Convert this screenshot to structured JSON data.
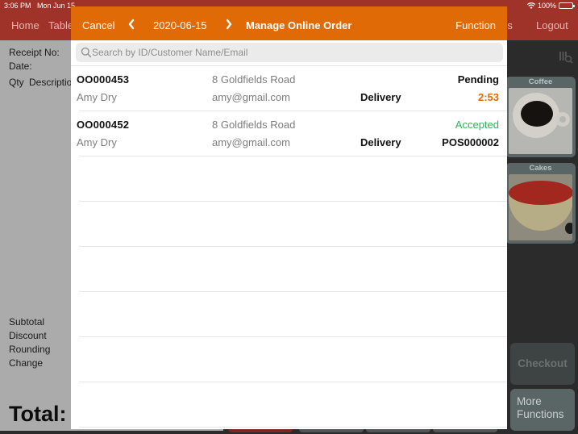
{
  "status_bar": {
    "time": "3:06 PM",
    "date": "Mon Jun 15",
    "battery": "100%"
  },
  "top_nav": {
    "home": "Home",
    "table": "Table",
    "functions": "ions",
    "logout": "Logout"
  },
  "receipt": {
    "receipt_no_label": "Receipt No:",
    "date_label": "Date:",
    "qty_label": "Qty",
    "description_label": "Descriptio",
    "subtotal_label": "Subtotal",
    "discount_label": "Discount",
    "rounding_label": "Rounding",
    "change_label": "Change",
    "total_label": "Total:"
  },
  "categories": [
    {
      "label": "Coffee",
      "icon": "coffee-cup-image"
    },
    {
      "label": "Cakes",
      "icon": "strawberry-cake-image"
    }
  ],
  "actions": {
    "checkout": "Checkout",
    "more_functions_line1": "More",
    "more_functions_line2": "Functions"
  },
  "modal": {
    "cancel": "Cancel",
    "date": "2020-06-15",
    "title": "Manage Online Order",
    "function": "Function",
    "search": {
      "placeholder": "Search by ID/Customer Name/Email",
      "value": ""
    },
    "colors": {
      "header": "#e06a06",
      "pending_timer": "#e06a06",
      "accepted": "#2fb554"
    },
    "orders": [
      {
        "id": "OO000453",
        "address": "8 Goldfields Road",
        "status": "Pending",
        "customer": "Amy Dry",
        "email": "amy@gmail.com",
        "type": "Delivery",
        "extra": "2:53"
      },
      {
        "id": "OO000452",
        "address": "8 Goldfields Road",
        "status": "Accepted",
        "customer": "Amy Dry",
        "email": "amy@gmail.com",
        "type": "Delivery",
        "extra": "POS000002"
      }
    ]
  }
}
